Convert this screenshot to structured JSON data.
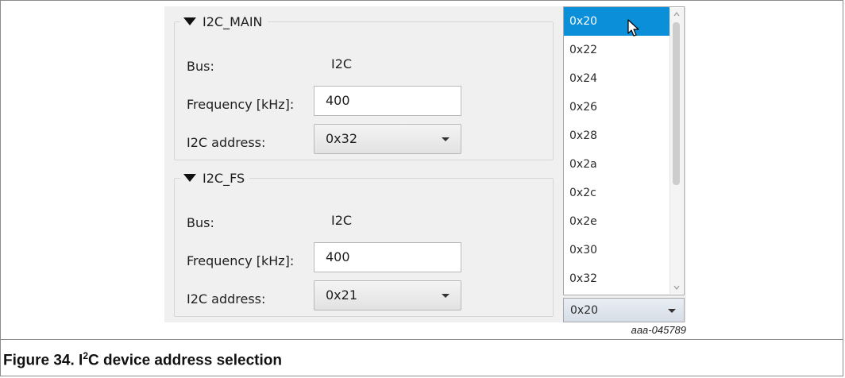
{
  "panels": [
    {
      "title": "I2C_MAIN",
      "bus_label": "Bus:",
      "bus_value": "I2C",
      "frequency_label": "Frequency [kHz]:",
      "frequency_value": "400",
      "address_label": "I2C address:",
      "address_value": "0x32"
    },
    {
      "title": "I2C_FS",
      "bus_label": "Bus:",
      "bus_value": "I2C",
      "frequency_label": "Frequency [kHz]:",
      "frequency_value": "400",
      "address_label": "I2C address:",
      "address_value": "0x21"
    }
  ],
  "address_dropdown": {
    "options": [
      "0x20",
      "0x22",
      "0x24",
      "0x26",
      "0x28",
      "0x2a",
      "0x2c",
      "0x2e",
      "0x30",
      "0x32"
    ],
    "highlighted": "0x20",
    "current_value": "0x20",
    "highlight_color": "#0a8fd8"
  },
  "figure_tag": "aaa-045789",
  "caption": {
    "prefix": "Figure 34.  I",
    "superscript": "2",
    "suffix": "C device address selection"
  }
}
